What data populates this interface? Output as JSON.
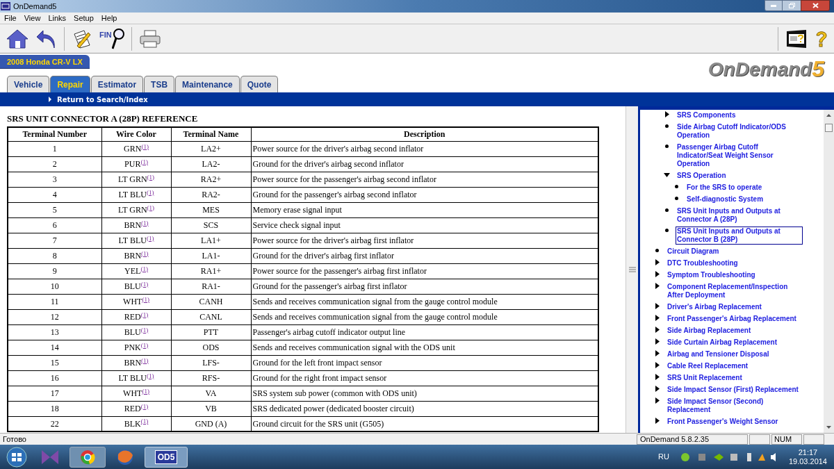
{
  "window": {
    "title": "OnDemand5"
  },
  "menu": [
    "File",
    "View",
    "Links",
    "Setup",
    "Help"
  ],
  "toolbar": {
    "find_label": "FIN"
  },
  "vehicle": "2008 Honda CR-V LX",
  "logo": {
    "name": "OnDemand",
    "digit": "5"
  },
  "tabs": [
    {
      "label": "Vehicle",
      "selected": false
    },
    {
      "label": "Repair",
      "selected": true
    },
    {
      "label": "Estimator",
      "selected": false
    },
    {
      "label": "TSB",
      "selected": false
    },
    {
      "label": "Maintenance",
      "selected": false
    },
    {
      "label": "Quote",
      "selected": false
    }
  ],
  "return_link": "Return to Search/Index",
  "document": {
    "title": "SRS UNIT CONNECTOR A (28P) REFERENCE",
    "columns": [
      "Terminal Number",
      "Wire Color",
      "Terminal Name",
      "Description"
    ],
    "rows": [
      {
        "number": "1",
        "wire": "GRN",
        "note": "(1)",
        "name": "LA2+",
        "description": "Power source for the driver's airbag second inflator"
      },
      {
        "number": "2",
        "wire": "PUR",
        "note": "(1)",
        "name": "LA2-",
        "description": "Ground for the driver's airbag second inflator"
      },
      {
        "number": "3",
        "wire": "LT GRN",
        "note": "(1)",
        "name": "RA2+",
        "description": "Power source for the passenger's airbag second inflator"
      },
      {
        "number": "4",
        "wire": "LT BLU",
        "note": "(1)",
        "name": "RA2-",
        "description": "Ground for the passenger's airbag second inflator"
      },
      {
        "number": "5",
        "wire": "LT GRN",
        "note": "(1)",
        "name": "MES",
        "description": "Memory erase signal input"
      },
      {
        "number": "6",
        "wire": "BRN",
        "note": "(1)",
        "name": "SCS",
        "description": "Service check signal input"
      },
      {
        "number": "7",
        "wire": "LT BLU",
        "note": "(1)",
        "name": "LA1+",
        "description": "Power source for the driver's airbag first inflator"
      },
      {
        "number": "8",
        "wire": "BRN",
        "note": "(1)",
        "name": "LA1-",
        "description": "Ground for the driver's airbag first inflator"
      },
      {
        "number": "9",
        "wire": "YEL",
        "note": "(1)",
        "name": "RA1+",
        "description": "Power source for the passenger's airbag first inflator"
      },
      {
        "number": "10",
        "wire": "BLU",
        "note": "(1)",
        "name": "RA1-",
        "description": "Ground for the passenger's airbag first inflator"
      },
      {
        "number": "11",
        "wire": "WHT",
        "note": "(1)",
        "name": "CANH",
        "description": "Sends and receives communication signal from the gauge control module"
      },
      {
        "number": "12",
        "wire": "RED",
        "note": "(1)",
        "name": "CANL",
        "description": "Sends and receives communication signal from the gauge control module"
      },
      {
        "number": "13",
        "wire": "BLU",
        "note": "(1)",
        "name": "PTT",
        "description": "Passenger's airbag cutoff indicator output line"
      },
      {
        "number": "14",
        "wire": "PNK",
        "note": "(1)",
        "name": "ODS",
        "description": "Sends and receives communication signal with the ODS unit"
      },
      {
        "number": "15",
        "wire": "BRN",
        "note": "(1)",
        "name": "LFS-",
        "description": "Ground for the left front impact sensor"
      },
      {
        "number": "16",
        "wire": "LT BLU",
        "note": "(1)",
        "name": "RFS-",
        "description": "Ground for the right front impact sensor"
      },
      {
        "number": "17",
        "wire": "WHT",
        "note": "(1)",
        "name": "VA",
        "description": "SRS system sub power (common with ODS unit)"
      },
      {
        "number": "18",
        "wire": "RED",
        "note": "(1)",
        "name": "VB",
        "description": "SRS dedicated power (dedicated booster circuit)"
      },
      {
        "number": "22",
        "wire": "BLK",
        "note": "(1)",
        "name": "GND (A)",
        "description": "Ground circuit for the SRS unit (G505)"
      }
    ]
  },
  "tree": [
    {
      "children": [
        {
          "kind": "collapsed",
          "label": "SRS Components",
          "selected": false
        },
        {
          "kind": "leaf",
          "label": "Side Airbag Cutoff Indicator/ODS Operation",
          "selected": false
        },
        {
          "kind": "leaf",
          "label": "Passenger Airbag Cutoff Indicator/Seat Weight Sensor Operation",
          "selected": false
        },
        {
          "kind": "expanded",
          "label": "SRS Operation",
          "selected": false,
          "children": [
            {
              "kind": "leaf",
              "label": "For the SRS to operate",
              "selected": false
            },
            {
              "kind": "leaf",
              "label": "Self-diagnostic System",
              "selected": false
            }
          ]
        },
        {
          "kind": "leaf",
          "label": "SRS Unit Inputs and Outputs at Connector A (28P)",
          "selected": false
        },
        {
          "kind": "leaf",
          "label": "SRS Unit Inputs and Outputs at Connector B (28P)",
          "selected": true
        }
      ]
    },
    {
      "kind": "leaf",
      "label": "Circuit Diagram",
      "selected": false
    },
    {
      "kind": "collapsed",
      "label": "DTC Troubleshooting",
      "selected": false
    },
    {
      "kind": "collapsed",
      "label": "Symptom Troubleshooting",
      "selected": false
    },
    {
      "kind": "collapsed",
      "label": "Component Replacement/Inspection After Deployment",
      "selected": false
    },
    {
      "kind": "collapsed",
      "label": "Driver's Airbag Replacement",
      "selected": false
    },
    {
      "kind": "collapsed",
      "label": "Front Passenger's Airbag Replacement",
      "selected": false
    },
    {
      "kind": "collapsed",
      "label": "Side Airbag Replacement",
      "selected": false
    },
    {
      "kind": "collapsed",
      "label": "Side Curtain Airbag Replacement",
      "selected": false
    },
    {
      "kind": "collapsed",
      "label": "Airbag and Tensioner Disposal",
      "selected": false
    },
    {
      "kind": "collapsed",
      "label": "Cable Reel Replacement",
      "selected": false
    },
    {
      "kind": "collapsed",
      "label": "SRS Unit Replacement",
      "selected": false
    },
    {
      "kind": "collapsed",
      "label": "Side Impact Sensor (First) Replacement",
      "selected": false
    },
    {
      "kind": "collapsed",
      "label": "Side Impact Sensor (Second) Replacement",
      "selected": false
    },
    {
      "kind": "collapsed",
      "label": "Front Passenger's Weight Sensor",
      "selected": false
    }
  ],
  "status_bar": {
    "message": "Готово",
    "version": "OnDemand 5.8.2.35",
    "num_lock": "NUM"
  },
  "taskbar": {
    "app_label": "OD5",
    "language": "RU",
    "time": "21:17",
    "date": "19.03.2014"
  }
}
